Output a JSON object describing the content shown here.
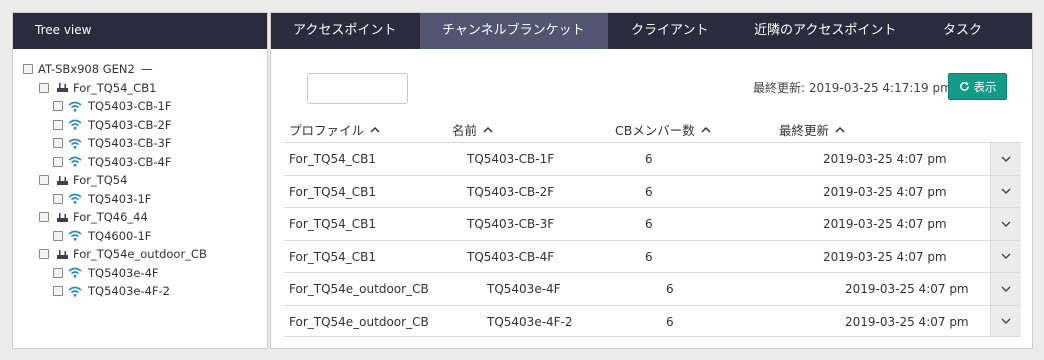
{
  "tree": {
    "header": "Tree view",
    "root": {
      "label": "AT-SBx908 GEN2",
      "collapse": "—"
    },
    "groups": [
      {
        "label": "For_TQ54_CB1",
        "children": [
          "TQ5403-CB-1F",
          "TQ5403-CB-2F",
          "TQ5403-CB-3F",
          "TQ5403-CB-4F"
        ]
      },
      {
        "label": "For_TQ54",
        "children": [
          "TQ5403-1F"
        ]
      },
      {
        "label": "For_TQ46_44",
        "children": [
          "TQ4600-1F"
        ]
      },
      {
        "label": "For_TQ54e_outdoor_CB",
        "children": [
          "TQ5403e-4F",
          "TQ5403e-4F-2"
        ]
      }
    ]
  },
  "tabs": [
    {
      "label": "アクセスポイント"
    },
    {
      "label": "チャンネルブランケット"
    },
    {
      "label": "クライアント"
    },
    {
      "label": "近隣のアクセスポイント"
    },
    {
      "label": "タスク"
    }
  ],
  "active_tab": 1,
  "filter": {
    "value": ""
  },
  "last_updated": "最終更新: 2019-03-25 4:17:19 pm",
  "refresh_button": "表示",
  "table": {
    "columns": [
      "プロファイル",
      "名前",
      "CBメンバー数",
      "最終更新"
    ],
    "rows": [
      {
        "profile": "For_TQ54_CB1",
        "name": "TQ5403-CB-1F",
        "cb_members": "6",
        "updated": "2019-03-25 4:07 pm"
      },
      {
        "profile": "For_TQ54_CB1",
        "name": "TQ5403-CB-2F",
        "cb_members": "6",
        "updated": "2019-03-25 4:07 pm"
      },
      {
        "profile": "For_TQ54_CB1",
        "name": "TQ5403-CB-3F",
        "cb_members": "6",
        "updated": "2019-03-25 4:07 pm"
      },
      {
        "profile": "For_TQ54_CB1",
        "name": "TQ5403-CB-4F",
        "cb_members": "6",
        "updated": "2019-03-25 4:07 pm"
      },
      {
        "profile": "For_TQ54e_outdoor_CB",
        "name": "TQ5403e-4F",
        "cb_members": "6",
        "updated": "2019-03-25 4:07 pm"
      },
      {
        "profile": "For_TQ54e_outdoor_CB",
        "name": "TQ5403e-4F-2",
        "cb_members": "6",
        "updated": "2019-03-25 4:07 pm"
      }
    ]
  },
  "colors": {
    "header_bg": "#2b2b3d",
    "active_tab_bg": "#525570",
    "accent": "#139b88",
    "wifi_icon": "#2a8cc4"
  },
  "icons": {
    "group": "router-icon",
    "ap": "wifi-icon",
    "sort": "chevron-up-icon",
    "expand": "chevron-down-icon",
    "refresh": "refresh-icon"
  }
}
